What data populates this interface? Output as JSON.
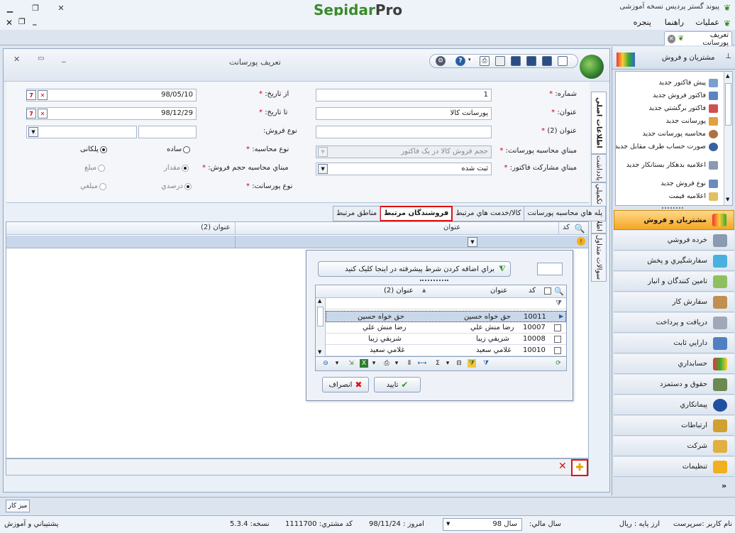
{
  "window": {
    "app_title": "پیوند گستر پردیس نسخه آموزشی",
    "logo_main": "Sepidar",
    "logo_suffix": "Pro"
  },
  "menu": {
    "items": [
      "عمليات",
      "راهنما",
      "پنجره"
    ]
  },
  "doc_tab": {
    "label": "تعریف پورسانت"
  },
  "document": {
    "title": "تعريف پورسانت",
    "side_tabs": [
      "اطلاعات اصلي",
      "يادداشت",
      "اطلاعات تکميلي",
      "سوالات متداول"
    ]
  },
  "form": {
    "number": {
      "label": "شماره:",
      "value": "1"
    },
    "title": {
      "label": "عنوان:",
      "value": "پورسانت کالا"
    },
    "title2": {
      "label": "عنوان (2)",
      "value": ""
    },
    "from_date": {
      "label": "از تاريخ:",
      "value": "98/05/10"
    },
    "to_date": {
      "label": "تا تاريخ:",
      "value": "98/12/29"
    },
    "sale_type": {
      "label": "نوع فروش:",
      "value": ""
    },
    "calc_type": {
      "label": "نوع محاسبه:",
      "option1": "ساده",
      "option2": "پلکانی"
    },
    "commission_basis": {
      "label": "مبناي محاسبه پورسانت:",
      "value": "حجم فروش کالا در يک فاکتور"
    },
    "invoice_share_basis": {
      "label": "مبناي مشارکت فاکتور:",
      "value": "ثبت شده"
    },
    "sales_volume_basis": {
      "label": "مبناي محاسبه حجم فروش:",
      "option1": "مقدار",
      "option2": "مبلغ"
    },
    "commission_type": {
      "label": "نوع پورسانت:",
      "option1": "درصدي",
      "option2": "مبلغي"
    }
  },
  "grid_tabs": [
    "پله هاي محاسبه پورسانت",
    "کالا/خدمت هاي مرتبط",
    "فروشندگان مرتبط",
    "مناطق مرتبط"
  ],
  "grid": {
    "col_code": "کد",
    "col_title": "عنوان",
    "col_title2": "عنوان (2)"
  },
  "popup": {
    "filter_button": "براي اضافه کردن شرط پيشرفته در اينجا کليک کنيد",
    "col_code": "کد",
    "col_title": "عنوان",
    "col_title2": "عنوان (2)",
    "rows": [
      {
        "code": "10011",
        "title": "حق خواه حسين",
        "title2": "حق خواه حسين"
      },
      {
        "code": "10007",
        "title": "رضا منش علي",
        "title2": "رضا منش علي"
      },
      {
        "code": "10008",
        "title": "شريفي زيبا",
        "title2": "شريفي زيبا"
      },
      {
        "code": "10010",
        "title": "غلامي سعيد",
        "title2": "غلامي سعيد"
      }
    ],
    "confirm": "تاييد",
    "cancel": "انصراف"
  },
  "navigator": {
    "header": "مشتريان و فروش",
    "list": [
      "پيش فاکتور جديد",
      "فاکتور فروش جديد",
      "فاکتور برگشتي جديد",
      "پورسانت جديد",
      "محاسبه پورسانت جديد",
      "صورت حساب طرف مقابل جديد",
      "اعلاميه بدهکار بستانکار جديد",
      "نوع فروش جديد",
      "اعلاميه قيمت"
    ],
    "modules": [
      "مشتريان و فروش",
      "خرده فروشي",
      "سفارشگيري و پخش",
      "تامين کنندگان و انبار",
      "سفارش کار",
      "دريافت و پرداخت",
      "دارايي ثابت",
      "حسابداري",
      "حقوق و دستمزد",
      "پيمانکاري",
      "ارتباطات",
      "شرکت",
      "تنظيمات"
    ]
  },
  "taskbar": {
    "desk": "ميز کار"
  },
  "status": {
    "user": "نام کاربر :سرپرست",
    "base_currency": "ارز پايه :   ريال",
    "fiscal_year_label": "سال مالي:",
    "fiscal_year": "سال 98",
    "today": "امروز :   98/11/24",
    "customer_code": "کد مشتري:   1111700",
    "version": "نسخه:   5.3.4",
    "support": "پشتيباني و آموزش"
  },
  "colors": {
    "accent_orange": "#f5a623",
    "highlight_red": "#e01010",
    "grid_selected": "#c9d7ea"
  }
}
